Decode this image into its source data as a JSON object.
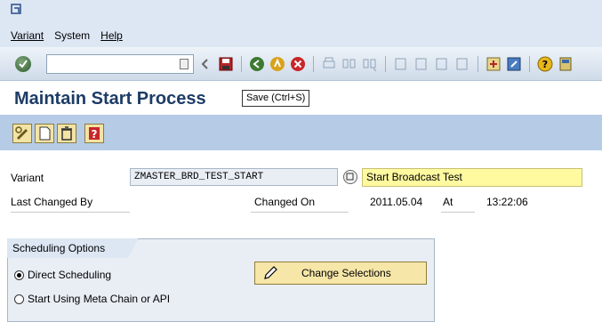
{
  "menu": {
    "items": [
      {
        "label": "Variant"
      },
      {
        "label": "System"
      },
      {
        "label": "Help"
      }
    ]
  },
  "toolbar": {
    "command_field_value": ""
  },
  "title": {
    "text": "Maintain Start Process",
    "tooltip": "Save  (Ctrl+S)"
  },
  "fields": {
    "variant_label": "Variant",
    "variant_value": "ZMASTER_BRD_TEST_START",
    "variant_description": "Start Broadcast Test",
    "last_changed_by_label": "Last Changed By",
    "last_changed_by_value": "",
    "changed_on_label": "Changed On",
    "changed_on_value": "2011.05.04",
    "at_label": "At",
    "at_value": "13:22:06"
  },
  "scheduling": {
    "group_title": "Scheduling Options",
    "options": [
      {
        "label": "Direct Scheduling",
        "selected": true
      },
      {
        "label": "Start Using Meta Chain or API",
        "selected": false
      }
    ],
    "change_selections_label": "Change Selections"
  }
}
